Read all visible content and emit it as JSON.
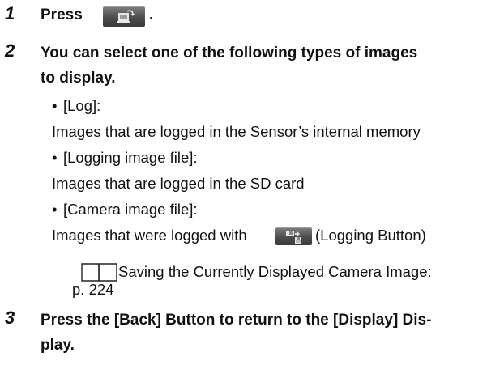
{
  "steps": [
    {
      "number": "1",
      "text_before_icon": "Press",
      "text_after_icon": ".",
      "icon": "display-change-icon"
    },
    {
      "number": "2",
      "line1": "You can select one of the following types of images",
      "line2": "to display."
    },
    {
      "number": "3",
      "line1": "Press the [Back] Button to return to the [Display] Dis-",
      "line2": "play."
    }
  ],
  "options": [
    {
      "bullet": "•",
      "label": "[Log]:",
      "description": "Images that are logged in the Sensor’s internal memory"
    },
    {
      "bullet": "•",
      "label": "[Logging image file]:",
      "description": "Images that are logged in the SD card"
    },
    {
      "bullet": "•",
      "label": "[Camera image file]:",
      "description_before_icon": "Images that were logged with",
      "description_after_icon": "(Logging Button)",
      "icon": "logging-button-icon"
    }
  ],
  "reference": {
    "icon": "book-icon",
    "title": "Saving the Currently Displayed Camera Image:",
    "page": "p. 224"
  },
  "colors": {
    "text": "#111111",
    "button_gradient_top": "#7f7f7f",
    "button_gradient_bottom": "#3a3a3a"
  }
}
